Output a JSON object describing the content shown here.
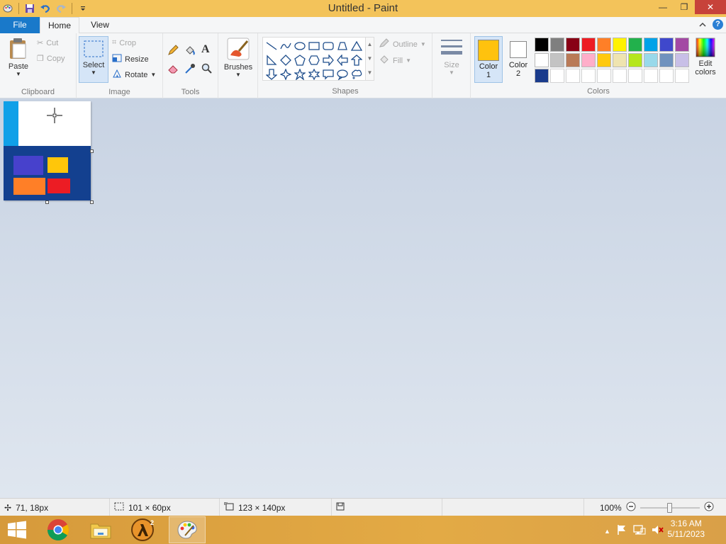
{
  "window": {
    "title": "Untitled - Paint",
    "minimize": "—",
    "restore": "❐",
    "close": "✕"
  },
  "tabs": {
    "file": "File",
    "home": "Home",
    "view": "View",
    "help": "?"
  },
  "clipboard": {
    "group": "Clipboard",
    "paste": "Paste",
    "cut": "Cut",
    "copy": "Copy"
  },
  "image": {
    "group": "Image",
    "select": "Select",
    "crop": "Crop",
    "resize": "Resize",
    "rotate": "Rotate"
  },
  "tools": {
    "group": "Tools",
    "text_glyph": "A"
  },
  "brushes": {
    "label": "Brushes"
  },
  "shapes": {
    "group": "Shapes",
    "outline": "Outline",
    "fill": "Fill"
  },
  "size": {
    "label": "Size"
  },
  "colors": {
    "group": "Colors",
    "color1_label": "Color",
    "color1_num": "1",
    "color2_label": "Color",
    "color2_num": "2",
    "edit_label": "Edit",
    "edit_label2": "colors",
    "color1_value": "#ffc20e",
    "color2_value": "#ffffff",
    "palette": [
      "#000000",
      "#7f7f7f",
      "#880015",
      "#ed1c24",
      "#ff7f27",
      "#fff200",
      "#22b14c",
      "#00a2e8",
      "#3f48cc",
      "#a349a4",
      "#ffffff",
      "#c3c3c3",
      "#b97a57",
      "#ffaec9",
      "#ffc90e",
      "#efe4b0",
      "#b5e61d",
      "#99d9ea",
      "#7092be",
      "#c8bfe7",
      "#1a3b8c",
      "#ffffff",
      "#ffffff",
      "#ffffff",
      "#ffffff",
      "#ffffff",
      "#ffffff",
      "#ffffff",
      "#ffffff",
      "#ffffff"
    ]
  },
  "status": {
    "cursor_pos": "71, 18px",
    "selection_size": "101 × 60px",
    "canvas_size": "123 × 140px",
    "zoom": "100%"
  },
  "taskbar": {
    "time": "3:16 AM",
    "date": "5/11/2023",
    "hl_badge": "2"
  }
}
